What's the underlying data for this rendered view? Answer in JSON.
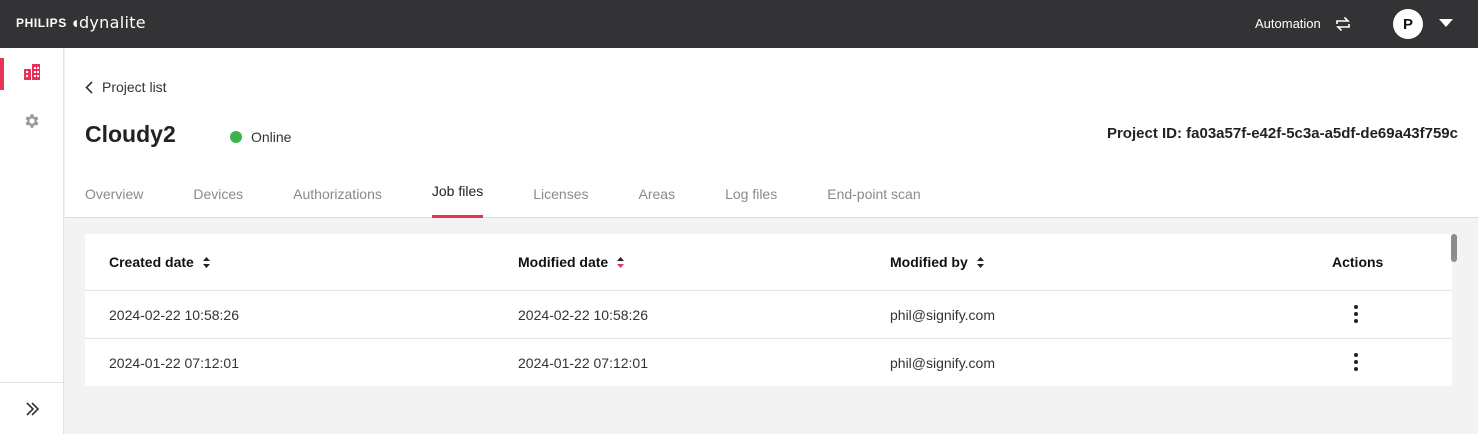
{
  "topbar": {
    "brand_primary": "PHILIPS",
    "brand_secondary": "dynalite",
    "automation_label": "Automation",
    "avatar_initial": "P",
    "swap_icon": "swap-arrows-icon",
    "menu_icon": "caret-down-icon"
  },
  "sidebar": {
    "items": [
      {
        "icon": "buildings-icon",
        "active": true
      },
      {
        "icon": "gear-icon",
        "active": false
      }
    ],
    "expand_icon": "double-chevron-right-icon"
  },
  "header": {
    "back_label": "Project list",
    "project_title": "Cloudy2",
    "status": "Online",
    "project_id_label": "Project ID: fa03a57f-e42f-5c3a-a5df-de69a43f759c"
  },
  "tabs": [
    {
      "label": "Overview"
    },
    {
      "label": "Devices"
    },
    {
      "label": "Authorizations"
    },
    {
      "label": "Job files",
      "active": true
    },
    {
      "label": "Licenses"
    },
    {
      "label": "Areas"
    },
    {
      "label": "Log files"
    },
    {
      "label": "End-point scan"
    }
  ],
  "table": {
    "columns": {
      "created": "Created date",
      "modified": "Modified date",
      "modified_by": "Modified by",
      "actions": "Actions"
    },
    "rows": [
      {
        "created": "2024-02-22 10:58:26",
        "modified": "2024-02-22 10:58:26",
        "modified_by": "phil@signify.com"
      },
      {
        "created": "2024-01-22 07:12:01",
        "modified": "2024-01-22 07:12:01",
        "modified_by": "phil@signify.com"
      }
    ]
  },
  "colors": {
    "topbar": "#333336",
    "accent": "#e8325a",
    "online": "#3cb44b"
  }
}
